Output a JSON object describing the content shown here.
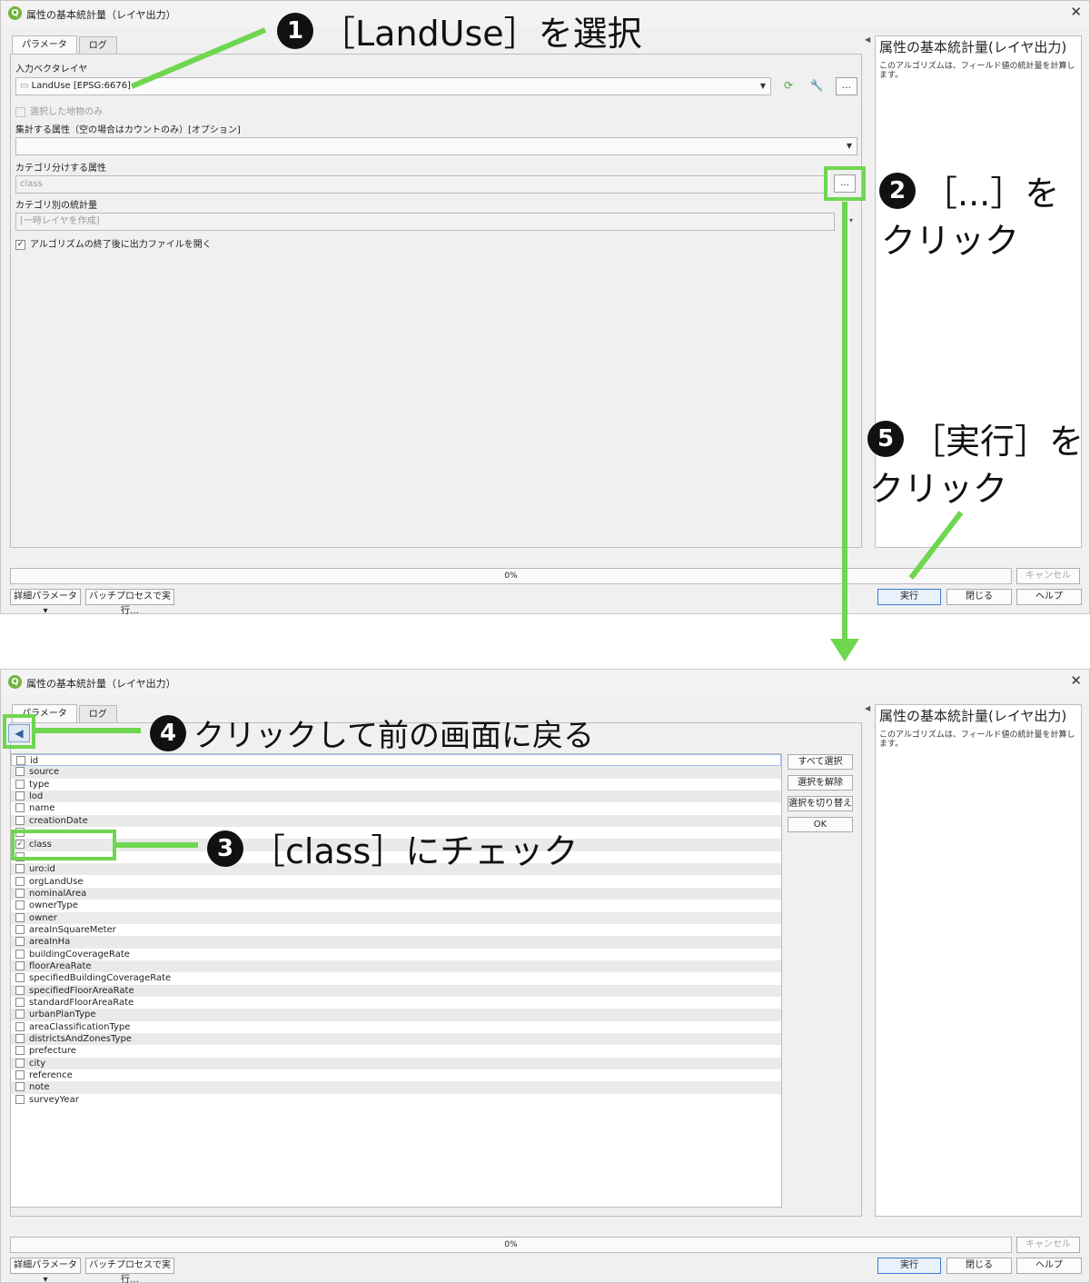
{
  "window": {
    "title": "属性の基本統計量（レイヤ出力）",
    "close_glyph": "✕"
  },
  "tabs": [
    "パラメータ",
    "ログ"
  ],
  "form": {
    "input_layer_label": "入力ベクタレイヤ",
    "input_layer_value": "LandUse [EPSG:6676]",
    "selected_only_label": "選択した地物のみ",
    "field_to_calc_label": "集計する属性（空の場合はカウントのみ）[オプション]",
    "field_to_calc_value": "",
    "category_field_label": "カテゴリ分けする属性",
    "category_field_value": "class",
    "output_label": "カテゴリ別の統計量",
    "output_placeholder": "[一時レイヤを作成]",
    "open_output_label": "アルゴリズムの終了後に出力ファイルを開く",
    "ellipsis": "…"
  },
  "help": {
    "title": "属性の基本統計量(レイヤ出力)",
    "text": "このアルゴリズムは、フィールド値の統計量を計算します。"
  },
  "bottom": {
    "progress_text": "0%",
    "cancel_label": "キャンセル",
    "advanced_label": "詳細パラメータ ▾",
    "batch_label": "バッチプロセスで実行…",
    "run_label": "実行",
    "close_label": "閉じる",
    "help_label": "ヘルプ"
  },
  "fieldlist": {
    "select_all_label": "すべて選択",
    "deselect_label": "選択を解除",
    "toggle_label": "選択を切り替え",
    "ok_label": "OK",
    "items": [
      {
        "name": "id",
        "checked": false
      },
      {
        "name": "source",
        "checked": false
      },
      {
        "name": "type",
        "checked": false
      },
      {
        "name": "lod",
        "checked": false
      },
      {
        "name": "name",
        "checked": false
      },
      {
        "name": "creationDate",
        "checked": false
      },
      {
        "name": "",
        "checked": false
      },
      {
        "name": "class",
        "checked": true
      },
      {
        "name": "",
        "checked": false
      },
      {
        "name": "uro:id",
        "checked": false
      },
      {
        "name": "orgLandUse",
        "checked": false
      },
      {
        "name": "nominalArea",
        "checked": false
      },
      {
        "name": "ownerType",
        "checked": false
      },
      {
        "name": "owner",
        "checked": false
      },
      {
        "name": "areaInSquareMeter",
        "checked": false
      },
      {
        "name": "areaInHa",
        "checked": false
      },
      {
        "name": "buildingCoverageRate",
        "checked": false
      },
      {
        "name": "floorAreaRate",
        "checked": false
      },
      {
        "name": "specifiedBuildingCoverageRate",
        "checked": false
      },
      {
        "name": "specifiedFloorAreaRate",
        "checked": false
      },
      {
        "name": "standardFloorAreaRate",
        "checked": false
      },
      {
        "name": "urbanPlanType",
        "checked": false
      },
      {
        "name": "areaClassificationType",
        "checked": false
      },
      {
        "name": "districtsAndZonesType",
        "checked": false
      },
      {
        "name": "prefecture",
        "checked": false
      },
      {
        "name": "city",
        "checked": false
      },
      {
        "name": "reference",
        "checked": false
      },
      {
        "name": "note",
        "checked": false
      },
      {
        "name": "surveyYear",
        "checked": false
      }
    ]
  },
  "annotations": {
    "step1": {
      "num": "1",
      "text": "［LandUse］を選択"
    },
    "step2": {
      "num": "2",
      "text": "［...］を",
      "text2": "クリック"
    },
    "step3": {
      "num": "3",
      "text": "［class］にチェック"
    },
    "step4": {
      "num": "4",
      "text": "クリックして前の画面に戻る"
    },
    "step5": {
      "num": "5",
      "text": "［実行］を",
      "text2": "クリック"
    },
    "accent_color": "#6fd650"
  }
}
